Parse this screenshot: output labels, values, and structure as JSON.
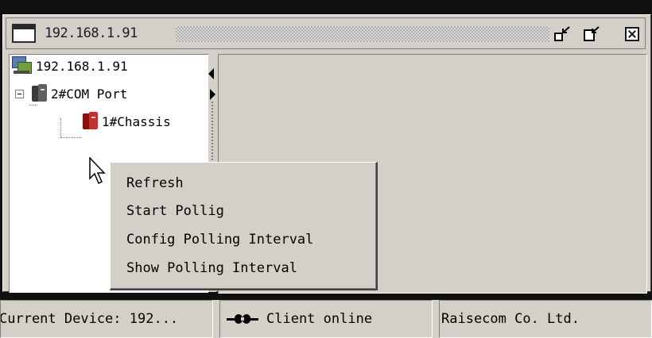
{
  "window": {
    "title": "192.168.1.91"
  },
  "tree": {
    "root_label": "192.168.1.91",
    "port_label": "2#COM Port",
    "chassis_label": "1#Chassis"
  },
  "context_menu": {
    "items": [
      {
        "label": "Refresh"
      },
      {
        "label": "Start Pollig"
      },
      {
        "label": "Config Polling Interval"
      },
      {
        "label": "Show Polling Interval"
      }
    ]
  },
  "statusbar": {
    "current_device": "Current Device: 192...",
    "client_status": "Client online",
    "company": "Raisecom Co. Ltd."
  },
  "icons": {
    "app": "window-icon",
    "minimize": "minimize-icon",
    "restore": "restore-icon",
    "close": "close-icon",
    "root": "computer-icon",
    "port": "server-icon",
    "chassis": "chassis-icon",
    "online": "plug-icon"
  }
}
